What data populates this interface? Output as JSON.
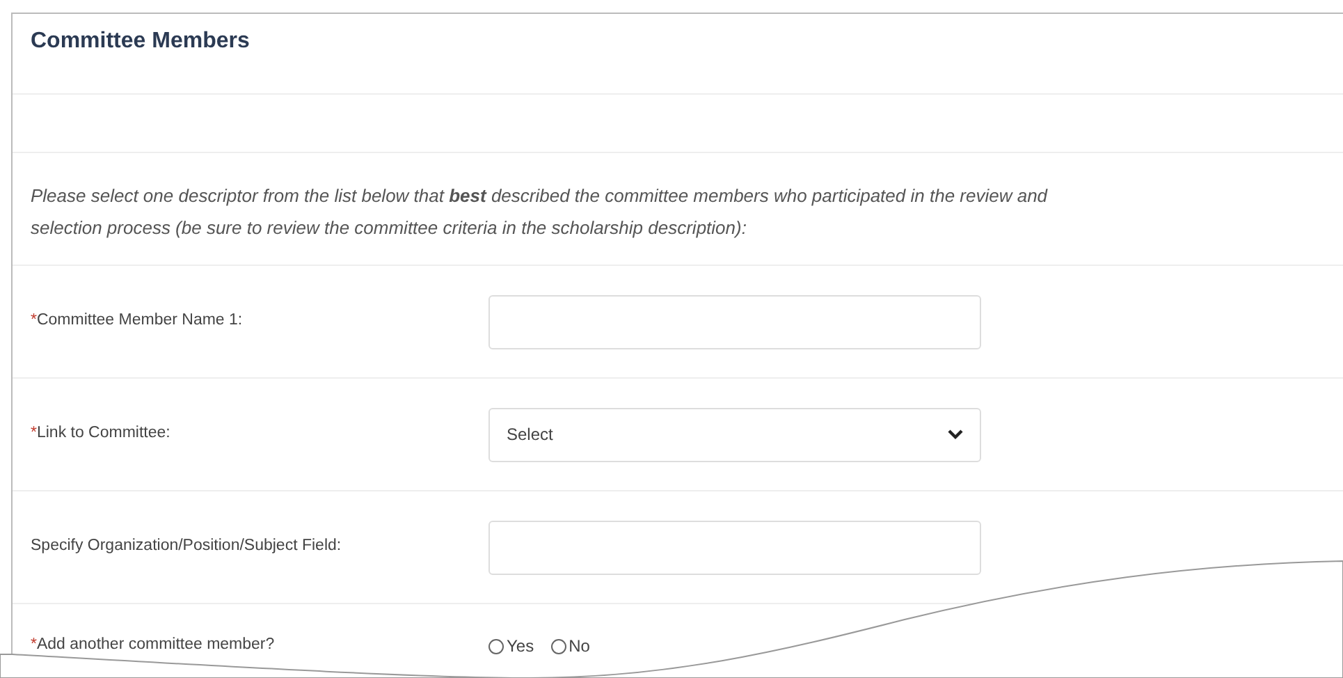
{
  "section": {
    "title": "Committee Members"
  },
  "instructions": "Please select one descriptor from the list below that **best** described the committee members who participated in the review and\nselection process (be sure to review the committee criteria in the scholarship description):",
  "fields": [
    {
      "kind": "text",
      "required_mark": "*",
      "label": "Committee Member Name 1:"
    },
    {
      "kind": "select",
      "required_mark": "*",
      "label": "Link to Committee:",
      "value": "Select"
    },
    {
      "kind": "text",
      "label": "Specify Organization/Position/Subject Field:"
    },
    {
      "kind": "radio",
      "required_mark": "*",
      "label": "Add another committee member?",
      "options": [
        {
          "label": "Yes",
          "selected": false
        },
        {
          "label": "No",
          "selected": false
        }
      ]
    }
  ]
}
